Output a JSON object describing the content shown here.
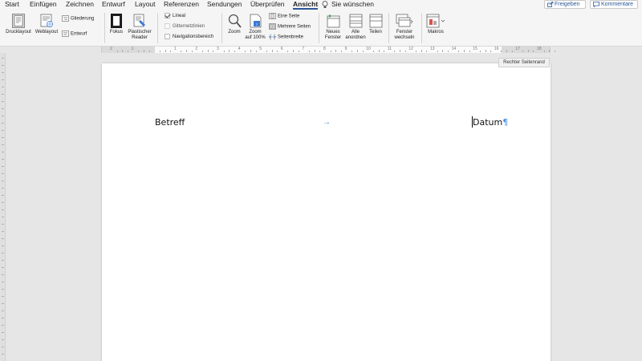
{
  "tabs": [
    {
      "label": "Start"
    },
    {
      "label": "Einfügen"
    },
    {
      "label": "Zeichnen"
    },
    {
      "label": "Entwurf"
    },
    {
      "label": "Layout"
    },
    {
      "label": "Referenzen"
    },
    {
      "label": "Sendungen"
    },
    {
      "label": "Überprüfen"
    },
    {
      "label": "Ansicht",
      "active": true
    }
  ],
  "tell_me": {
    "label": "Sie wünschen"
  },
  "header_buttons": {
    "share": "Freigeben",
    "comments": "Kommentare"
  },
  "ribbon": {
    "views": {
      "print_layout": "Drucklayout",
      "web_layout": "Weblayout",
      "outline": "Gliederung",
      "draft": "Entwurf"
    },
    "immersive": {
      "focus": "Fokus",
      "reader_1": "Plastischer",
      "reader_2": "Reader"
    },
    "show": {
      "ruler": "Lineal",
      "ruler_checked": true,
      "gridlines": "Gitternetzlinien",
      "gridlines_checked": false,
      "navigation": "Navigationsbereich",
      "navigation_checked": false
    },
    "zoom": {
      "zoom": "Zoom",
      "zoom100_1": "Zoom",
      "zoom100_2": "auf 100%",
      "one_page": "Eine Seite",
      "multiple_pages": "Mehrere Seiten",
      "page_width": "Seitenbreite"
    },
    "window": {
      "new_1": "Neues",
      "new_2": "Fenster",
      "arrange_1": "Alle",
      "arrange_2": "anordnen",
      "split": "Teilen",
      "switch_1": "Fenster",
      "switch_2": "wechseln"
    },
    "macros": {
      "label": "Makros"
    }
  },
  "ruler": {
    "numbers": [
      "2",
      "1",
      "",
      "1",
      "2",
      "3",
      "4",
      "5",
      "6",
      "7",
      "8",
      "9",
      "10",
      "11",
      "12",
      "13",
      "14",
      "15",
      "16",
      "17",
      "18"
    ]
  },
  "tooltip": {
    "text": "Rechter Seitenrand"
  },
  "document": {
    "left_text": "Betreff",
    "tab_mark": "→",
    "right_text": "Datum",
    "pilcrow": "¶"
  },
  "colors": {
    "accent": "#2b5797",
    "format_marks": "#4a90d9"
  }
}
